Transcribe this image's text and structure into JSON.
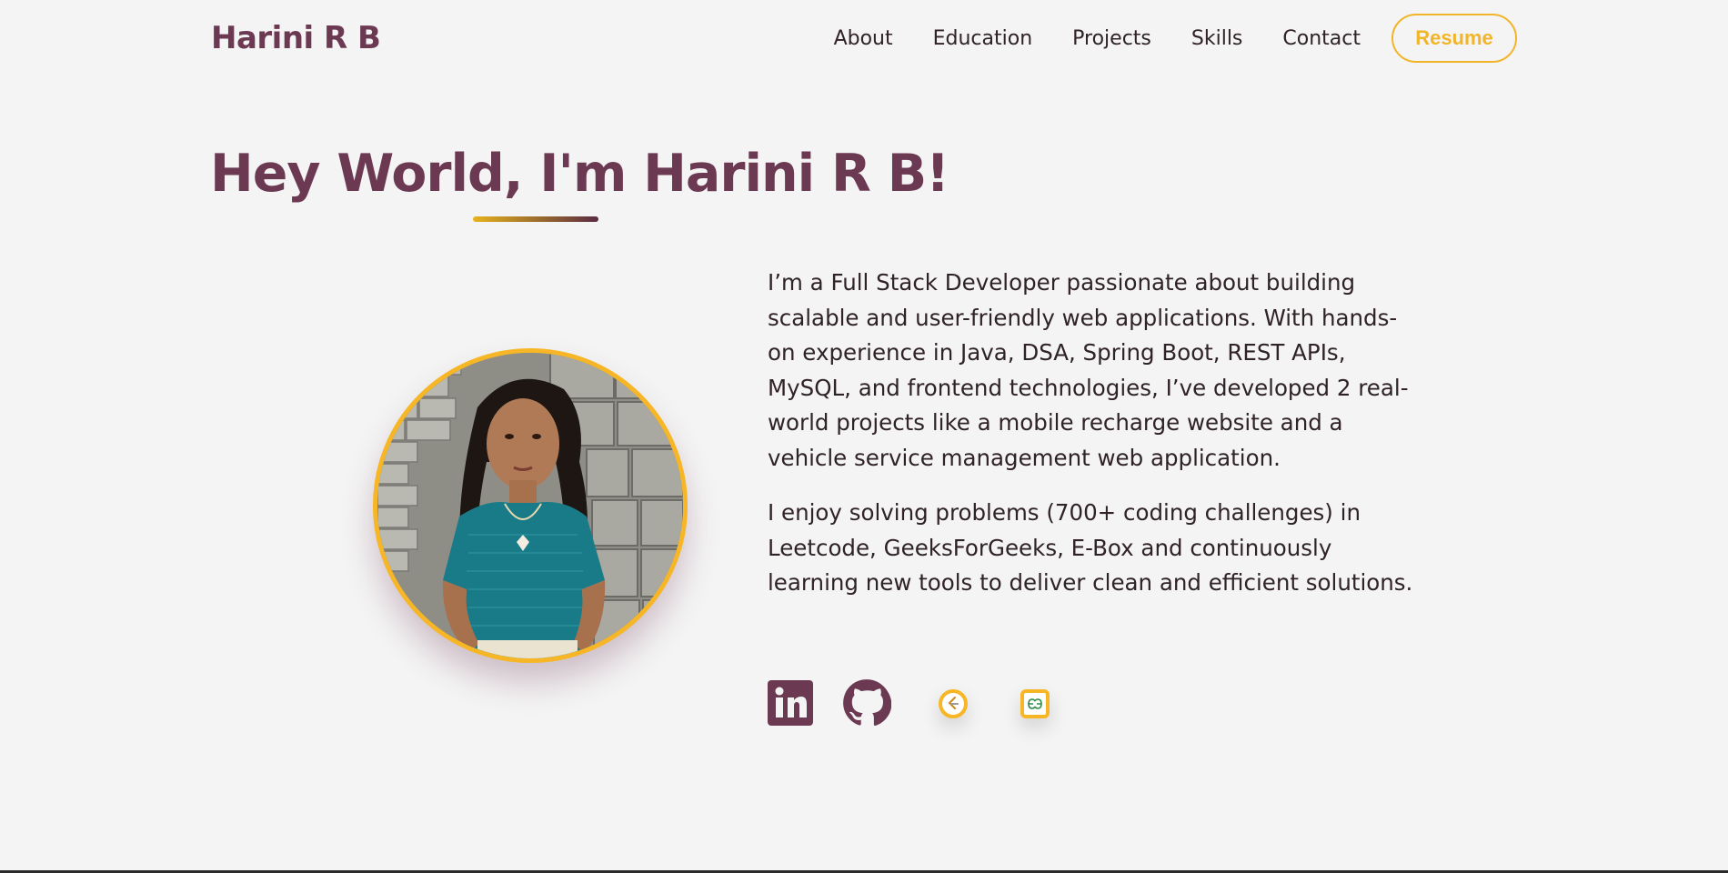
{
  "brand": {
    "name": "Harini R B"
  },
  "nav": {
    "links": [
      "About",
      "Education",
      "Projects",
      "Skills",
      "Contact"
    ],
    "resume_label": "Resume"
  },
  "hero": {
    "title": "Hey World, I'm Harini R B!",
    "about_paragraphs": [
      "I’m a Full Stack Developer passionate about building scalable and user-friendly web applications. With hands-on experience in Java, DSA, Spring Boot, REST APIs, MySQL, and frontend technologies, I’ve developed 2 real-world projects like a mobile recharge website and a vehicle service management web application.",
      "I enjoy solving problems (700+ coding challenges) in Leetcode, GeeksForGeeks, E-Box and continuously learning new tools to deliver clean and efficient solutions."
    ]
  },
  "socials": [
    {
      "icon": "linkedin-icon"
    },
    {
      "icon": "github-icon"
    },
    {
      "icon": "leetcode-icon"
    },
    {
      "icon": "geeksforgeeks-icon"
    }
  ],
  "colors": {
    "brand_plum": "#6b3a52",
    "accent_gold": "#f2b52a",
    "background": "#f4f4f4",
    "text": "#2f2228"
  }
}
